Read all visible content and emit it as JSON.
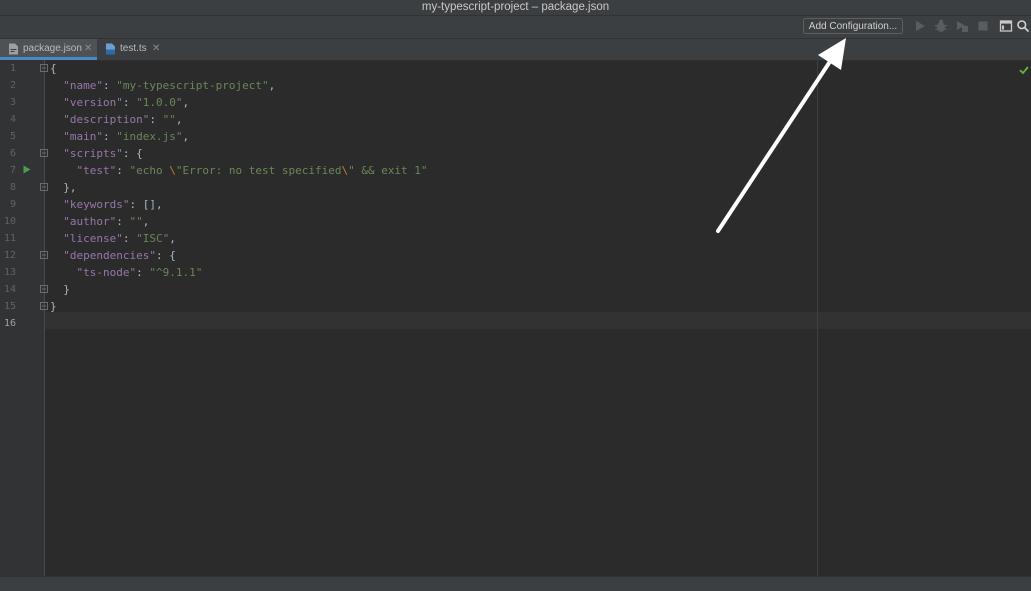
{
  "window": {
    "title": "my-typescript-project – package.json"
  },
  "toolbar": {
    "add_configuration_label": "Add Configuration...",
    "icons": [
      "run-icon",
      "debug-icon",
      "coverage-icon",
      "stop-icon",
      "layout-icon",
      "search-icon"
    ]
  },
  "tabs": [
    {
      "label": "package.json",
      "icon": "json-file-icon",
      "active": true
    },
    {
      "label": "test.ts",
      "icon": "typescript-file-icon",
      "active": false
    }
  ],
  "editor": {
    "current_line": "16",
    "line_numbers": [
      "1",
      "2",
      "3",
      "4",
      "5",
      "6",
      "7",
      "8",
      "9",
      "10",
      "11",
      "12",
      "13",
      "14",
      "15",
      "16"
    ],
    "lines": [
      "{",
      "  \"name\": \"my-typescript-project\",",
      "  \"version\": \"1.0.0\",",
      "  \"description\": \"\",",
      "  \"main\": \"index.js\",",
      "  \"scripts\": {",
      "    \"test\": \"echo \\\"Error: no test specified\\\" && exit 1\"",
      "  },",
      "  \"keywords\": [],",
      "  \"author\": \"\",",
      "  \"license\": \"ISC\",",
      "  \"dependencies\": {",
      "    \"ts-node\": \"^9.1.1\"",
      "  }",
      "}",
      ""
    ]
  },
  "colors": {
    "background": "#2b2b2b",
    "key": "#9876aa",
    "string": "#6a8759",
    "escape": "#cc7832",
    "punctuation": "#a9b7c6",
    "tab_underline": "#4a88c7",
    "run_marker": "#499c54"
  }
}
